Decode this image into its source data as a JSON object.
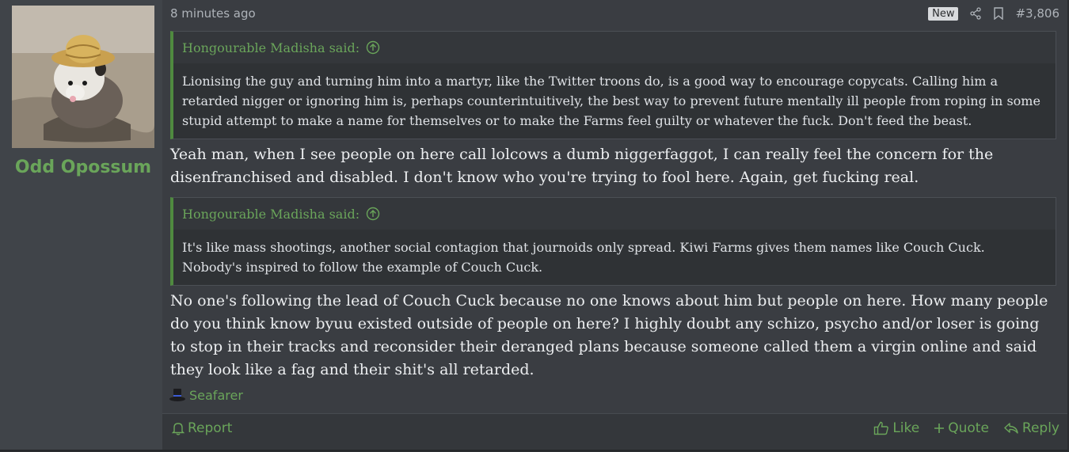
{
  "user": {
    "name": "Odd Opossum"
  },
  "meta": {
    "time": "8 minutes ago",
    "badge": "New",
    "post_number": "#3,806"
  },
  "quote1": {
    "author": "Hongourable Madisha said:",
    "text": "Lionising the guy and turning him into a martyr, like the Twitter troons do, is a good way to encourage copycats. Calling him a retarded nigger or ignoring him is, perhaps counterintuitively, the best way to prevent future mentally ill people from roping in some stupid attempt to make a name for themselves or to make the Farms feel guilty or whatever the fuck. Don't feed the beast."
  },
  "reply1": "Yeah man, when I see people on here call lolcows a dumb niggerfaggot, I can really feel the concern for the disenfranchised and disabled. I don't know who you're trying to fool here. Again, get fucking real.",
  "quote2": {
    "author": "Hongourable Madisha said:",
    "text": "It's like mass shootings, another social contagion that journoids only spread. Kiwi Farms gives them names like Couch Cuck. Nobody's inspired to follow the example of Couch Cuck."
  },
  "reply2": "No one's following the lead of Couch Cuck because no one knows about him but people on here. How many people do you think know byuu existed outside of people on here? I highly doubt any schizo, psycho and/or loser is going to stop in their tracks and reconsider their deranged plans because someone called them a virgin online and said they look like a fag and their shit's all retarded.",
  "signature": {
    "label": "Seafarer",
    "icon": "top-hat-icon"
  },
  "footer": {
    "report": "Report",
    "like": "Like",
    "quote": "Quote",
    "reply": "Reply"
  },
  "colors": {
    "accent": "#6aa55a",
    "background": "#3a3d42",
    "user_column": "#404449",
    "quote_bg": "#2f3235"
  }
}
